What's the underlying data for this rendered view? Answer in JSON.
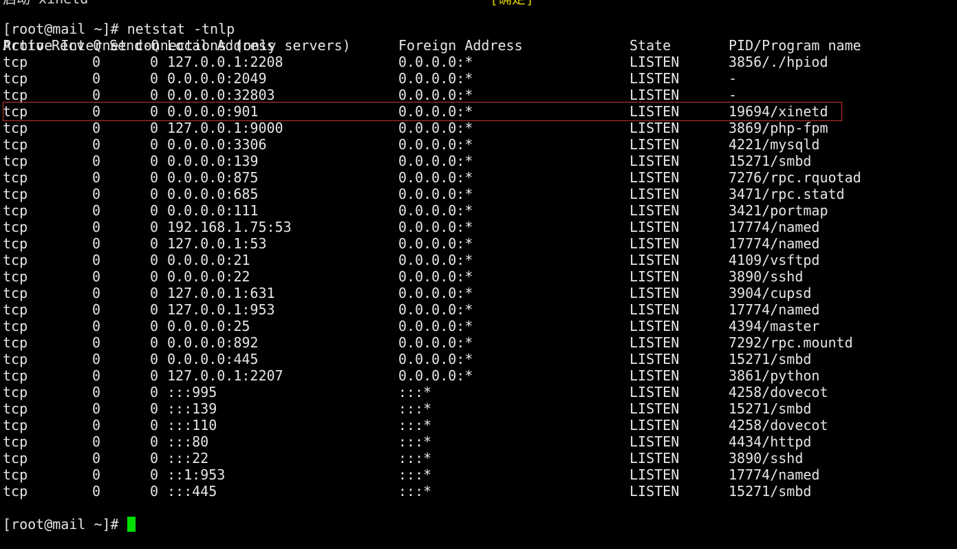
{
  "cut_off_top": {
    "left_text": "启动 xinetd",
    "right_text": "[确定]"
  },
  "command_line": {
    "prompt": "[root@mail ~]# ",
    "command": "netstat -tnlp"
  },
  "section_title": "Active Internet connections (only servers)",
  "columns": {
    "proto": "Proto",
    "recv_q": "Recv-Q",
    "send_q": "Send-Q",
    "local": "Local Address",
    "foreign": "Foreign Address",
    "state": "State",
    "program": "PID/Program name"
  },
  "rows": [
    {
      "proto": "tcp",
      "recv_q": "0",
      "send_q": "0",
      "local": "127.0.0.1:2208",
      "foreign": "0.0.0.0:*",
      "state": "LISTEN",
      "program": "3856/./hpiod"
    },
    {
      "proto": "tcp",
      "recv_q": "0",
      "send_q": "0",
      "local": "0.0.0.0:2049",
      "foreign": "0.0.0.0:*",
      "state": "LISTEN",
      "program": "-"
    },
    {
      "proto": "tcp",
      "recv_q": "0",
      "send_q": "0",
      "local": "0.0.0.0:32803",
      "foreign": "0.0.0.0:*",
      "state": "LISTEN",
      "program": "-"
    },
    {
      "proto": "tcp",
      "recv_q": "0",
      "send_q": "0",
      "local": "0.0.0.0:901",
      "foreign": "0.0.0.0:*",
      "state": "LISTEN",
      "program": "19694/xinetd"
    },
    {
      "proto": "tcp",
      "recv_q": "0",
      "send_q": "0",
      "local": "127.0.0.1:9000",
      "foreign": "0.0.0.0:*",
      "state": "LISTEN",
      "program": "3869/php-fpm"
    },
    {
      "proto": "tcp",
      "recv_q": "0",
      "send_q": "0",
      "local": "0.0.0.0:3306",
      "foreign": "0.0.0.0:*",
      "state": "LISTEN",
      "program": "4221/mysqld"
    },
    {
      "proto": "tcp",
      "recv_q": "0",
      "send_q": "0",
      "local": "0.0.0.0:139",
      "foreign": "0.0.0.0:*",
      "state": "LISTEN",
      "program": "15271/smbd"
    },
    {
      "proto": "tcp",
      "recv_q": "0",
      "send_q": "0",
      "local": "0.0.0.0:875",
      "foreign": "0.0.0.0:*",
      "state": "LISTEN",
      "program": "7276/rpc.rquotad"
    },
    {
      "proto": "tcp",
      "recv_q": "0",
      "send_q": "0",
      "local": "0.0.0.0:685",
      "foreign": "0.0.0.0:*",
      "state": "LISTEN",
      "program": "3471/rpc.statd"
    },
    {
      "proto": "tcp",
      "recv_q": "0",
      "send_q": "0",
      "local": "0.0.0.0:111",
      "foreign": "0.0.0.0:*",
      "state": "LISTEN",
      "program": "3421/portmap"
    },
    {
      "proto": "tcp",
      "recv_q": "0",
      "send_q": "0",
      "local": "192.168.1.75:53",
      "foreign": "0.0.0.0:*",
      "state": "LISTEN",
      "program": "17774/named"
    },
    {
      "proto": "tcp",
      "recv_q": "0",
      "send_q": "0",
      "local": "127.0.0.1:53",
      "foreign": "0.0.0.0:*",
      "state": "LISTEN",
      "program": "17774/named"
    },
    {
      "proto": "tcp",
      "recv_q": "0",
      "send_q": "0",
      "local": "0.0.0.0:21",
      "foreign": "0.0.0.0:*",
      "state": "LISTEN",
      "program": "4109/vsftpd"
    },
    {
      "proto": "tcp",
      "recv_q": "0",
      "send_q": "0",
      "local": "0.0.0.0:22",
      "foreign": "0.0.0.0:*",
      "state": "LISTEN",
      "program": "3890/sshd"
    },
    {
      "proto": "tcp",
      "recv_q": "0",
      "send_q": "0",
      "local": "127.0.0.1:631",
      "foreign": "0.0.0.0:*",
      "state": "LISTEN",
      "program": "3904/cupsd"
    },
    {
      "proto": "tcp",
      "recv_q": "0",
      "send_q": "0",
      "local": "127.0.0.1:953",
      "foreign": "0.0.0.0:*",
      "state": "LISTEN",
      "program": "17774/named"
    },
    {
      "proto": "tcp",
      "recv_q": "0",
      "send_q": "0",
      "local": "0.0.0.0:25",
      "foreign": "0.0.0.0:*",
      "state": "LISTEN",
      "program": "4394/master"
    },
    {
      "proto": "tcp",
      "recv_q": "0",
      "send_q": "0",
      "local": "0.0.0.0:892",
      "foreign": "0.0.0.0:*",
      "state": "LISTEN",
      "program": "7292/rpc.mountd"
    },
    {
      "proto": "tcp",
      "recv_q": "0",
      "send_q": "0",
      "local": "0.0.0.0:445",
      "foreign": "0.0.0.0:*",
      "state": "LISTEN",
      "program": "15271/smbd"
    },
    {
      "proto": "tcp",
      "recv_q": "0",
      "send_q": "0",
      "local": "127.0.0.1:2207",
      "foreign": "0.0.0.0:*",
      "state": "LISTEN",
      "program": "3861/python"
    },
    {
      "proto": "tcp",
      "recv_q": "0",
      "send_q": "0",
      "local": ":::995",
      "foreign": ":::*",
      "state": "LISTEN",
      "program": "4258/dovecot"
    },
    {
      "proto": "tcp",
      "recv_q": "0",
      "send_q": "0",
      "local": ":::139",
      "foreign": ":::*",
      "state": "LISTEN",
      "program": "15271/smbd"
    },
    {
      "proto": "tcp",
      "recv_q": "0",
      "send_q": "0",
      "local": ":::110",
      "foreign": ":::*",
      "state": "LISTEN",
      "program": "4258/dovecot"
    },
    {
      "proto": "tcp",
      "recv_q": "0",
      "send_q": "0",
      "local": ":::80",
      "foreign": ":::*",
      "state": "LISTEN",
      "program": "4434/httpd"
    },
    {
      "proto": "tcp",
      "recv_q": "0",
      "send_q": "0",
      "local": ":::22",
      "foreign": ":::*",
      "state": "LISTEN",
      "program": "3890/sshd"
    },
    {
      "proto": "tcp",
      "recv_q": "0",
      "send_q": "0",
      "local": "::1:953",
      "foreign": ":::*",
      "state": "LISTEN",
      "program": "17774/named"
    },
    {
      "proto": "tcp",
      "recv_q": "0",
      "send_q": "0",
      "local": ":::445",
      "foreign": ":::*",
      "state": "LISTEN",
      "program": "15271/smbd"
    }
  ],
  "final_prompt": "[root@mail ~]# ",
  "colors": {
    "background": "#000000",
    "text": "#e6e6e6",
    "cursor": "#00e000",
    "highlight_border": "#c0392b",
    "ok_status": "#d8c800"
  }
}
